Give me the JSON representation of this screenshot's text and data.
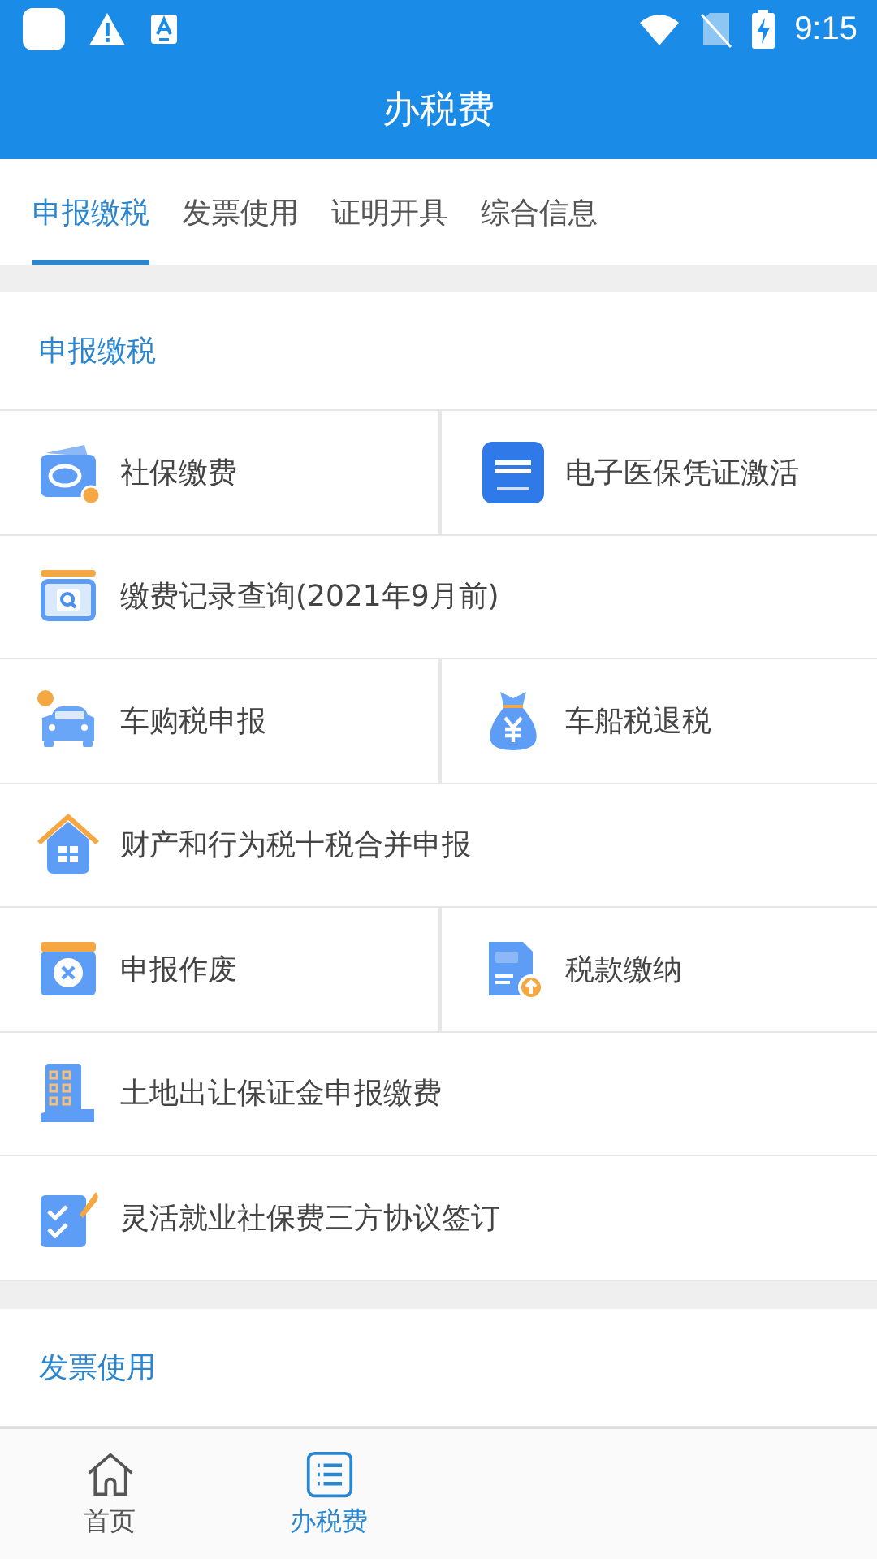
{
  "status_bar": {
    "time": "9:15"
  },
  "header": {
    "title": "办税费"
  },
  "tabs": [
    {
      "label": "申报缴税",
      "selected": true
    },
    {
      "label": "发票使用",
      "selected": false
    },
    {
      "label": "证明开具",
      "selected": false
    },
    {
      "label": "综合信息",
      "selected": false
    }
  ],
  "sections": [
    {
      "title": "申报缴税",
      "rows": [
        {
          "items": [
            {
              "label": "社保缴费",
              "kind": "wallet"
            },
            {
              "label": "电子医保凭证激活",
              "kind": "chs"
            }
          ]
        },
        {
          "items": [
            {
              "label": "缴费记录查询(2021年9月前)",
              "kind": "search-window"
            }
          ]
        },
        {
          "items": [
            {
              "label": "车购税申报",
              "kind": "car"
            },
            {
              "label": "车船税退税",
              "kind": "money-bag"
            }
          ]
        },
        {
          "items": [
            {
              "label": "财产和行为税十税合并申报",
              "kind": "house"
            }
          ]
        },
        {
          "items": [
            {
              "label": "申报作废",
              "kind": "cancel-window"
            },
            {
              "label": "税款缴纳",
              "kind": "tax-doc"
            }
          ]
        },
        {
          "items": [
            {
              "label": "土地出让保证金申报缴费",
              "kind": "building"
            }
          ]
        },
        {
          "items": [
            {
              "label": "灵活就业社保费三方协议签订",
              "kind": "checklist"
            }
          ]
        }
      ]
    },
    {
      "title": "发票使用"
    }
  ],
  "bottom_nav": [
    {
      "label": "首页",
      "kind": "home",
      "selected": false
    },
    {
      "label": "办税费",
      "kind": "list",
      "selected": true
    }
  ]
}
